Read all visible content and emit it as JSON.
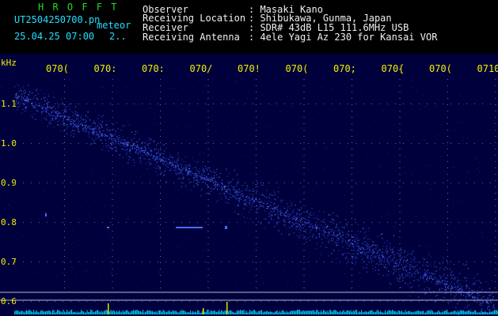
{
  "header": {
    "app_title": "H R O F F T",
    "file_name": "UT2504250700.pn",
    "meteor_label": "meteor",
    "date_time": "25.04.25 07:00",
    "count": "2..",
    "rows": [
      {
        "label": "Observer",
        "value": ": Masaki Kano"
      },
      {
        "label": "Receiving Location",
        "value": ": Shibukawa, Gunma, Japan"
      },
      {
        "label": "Receiver",
        "value": ": SDR# 43dB L15 111.6MHz USB"
      },
      {
        "label": "Receiving Antenna",
        "value": ": 4ele Yagi Az 230 for Kansai VOR"
      }
    ]
  },
  "axis": {
    "y_unit": "kHz",
    "y_ticks": [
      "1.1",
      "1.0",
      "0.9",
      "0.8",
      "0.7",
      "0.6"
    ],
    "x_ticks": [
      "070(",
      "070:",
      "070:",
      "070/",
      "070!",
      "070(",
      "070;",
      "070{",
      "070(",
      "0710"
    ]
  },
  "colors": {
    "background": "#00003c",
    "tick_text": "#f0f000",
    "header_label": "#f0f0f0",
    "file_text": "#22e0ff",
    "app_title": "#22dd22",
    "signal": "#3b5bff",
    "baseline": "#00b8e0"
  }
}
